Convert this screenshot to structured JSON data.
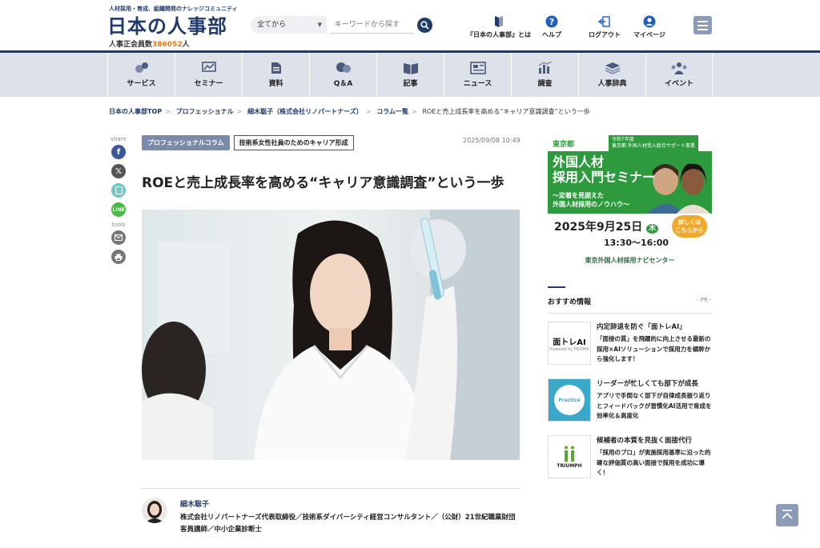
{
  "header": {
    "tagline": "人材採用・育成、組織開発のナレッジコミュニティ",
    "logo": "日本の人事部",
    "members_label": "人事正会員数",
    "members_count": "386052",
    "members_unit": "人",
    "search": {
      "scope": "全てから",
      "placeholder": "キーワードから探す"
    },
    "nav": [
      {
        "label": "『日本の人事部』とは",
        "icon": "book-icon"
      },
      {
        "label": "ヘルプ",
        "icon": "help-icon"
      },
      {
        "label": "ログアウト",
        "icon": "logout-icon"
      },
      {
        "label": "マイページ",
        "icon": "user-icon"
      }
    ]
  },
  "categories": [
    {
      "label": "サービス",
      "icon": "service-icon"
    },
    {
      "label": "セミナー",
      "icon": "seminar-icon"
    },
    {
      "label": "資料",
      "icon": "document-icon"
    },
    {
      "label": "Q＆A",
      "icon": "qa-icon"
    },
    {
      "label": "記事",
      "icon": "article-icon"
    },
    {
      "label": "ニュース",
      "icon": "news-icon"
    },
    {
      "label": "調査",
      "icon": "chart-icon"
    },
    {
      "label": "人事辞典",
      "icon": "dictionary-icon"
    },
    {
      "label": "イベント",
      "icon": "event-icon"
    }
  ],
  "breadcrumb": [
    "日本の人事部TOP",
    "プロフェッショナル",
    "細木聡子（株式会社リノパートナーズ）",
    "コラム一覧",
    "ROEと売上成長率を高める“キャリア意識調査”という一歩"
  ],
  "share": {
    "share_label": "share",
    "tools_label": "tools"
  },
  "article": {
    "tag_primary": "プロフェッショナルコラム",
    "tag_secondary": "技術系女性社員のためのキャリア形成",
    "date": "2025/09/08 10:49",
    "title": "ROEと売上成長率を高める“キャリア意識調査”という一歩",
    "author_name": "細木聡子",
    "author_bio": "株式会社リノパートナーズ代表取締役／技術系ダイバーシティ経営コンサルタント／（公財）21世紀職業財団客員講師／中小企業診断士"
  },
  "ad": {
    "org": "東京都",
    "project": "令和7年度\n東京都 外国人材受入総合サポート事業",
    "headline1": "外国人材",
    "headline2": "採用入門セミナー",
    "subline1": "～定着を見据えた",
    "subline2": "外国人材採用のノウハウ～",
    "date": "2025年9月25日",
    "day": "木",
    "time": "13:30～16:00",
    "cta": "詳しくは\nこちらから",
    "navi": "東京外国人材採用ナビセンター"
  },
  "recommend": {
    "title": "おすすめ情報",
    "pr": "- PR -",
    "items": [
      {
        "heading": "内定辞退を防ぐ「面トレAI」",
        "desc": "「面接の質」を飛躍的に向上させる最新の採用×AIソリューションで採用力を横幹から強化します！",
        "thumb": "面トレAI"
      },
      {
        "heading": "リーダーが忙しくても部下が成長",
        "desc": "アプリで手間なく部下が自律成長振り返りとフィードバックが習慣化AI活用で育成を効率化＆高度化",
        "thumb": "Practice"
      },
      {
        "heading": "候補者の本質を見抜く面接代行",
        "desc": "「採用のプロ」が実施採用基準に沿った的確な評価質の高い面接で採用を成功に導く！",
        "thumb": "TRIUMPH"
      }
    ]
  },
  "colors": {
    "brand": "#1f3a6b",
    "accent": "#e07a1f",
    "nav_bg": "#dde1ea",
    "ad_green": "#2e9a3e"
  }
}
